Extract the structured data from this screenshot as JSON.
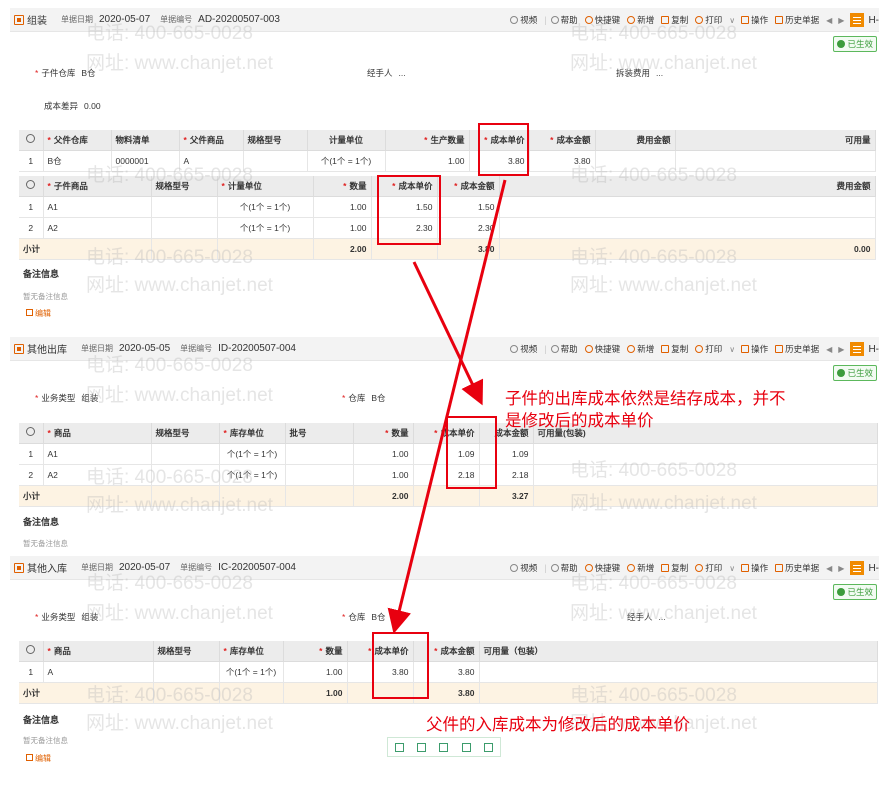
{
  "watermark": {
    "phone": "电话: 400-665-0028",
    "site": "网址: www.chanjet.net"
  },
  "common": {
    "date_label": "单据日期",
    "number_label": "单据编号",
    "subtotal_label": "小计",
    "notes_title": "备注信息",
    "notes_empty": "暂无备注信息",
    "edit_label": "编辑",
    "status": "已生效",
    "more": "H-"
  },
  "toolbar": {
    "video": "视频",
    "help": "帮助",
    "shortcut": "快捷键",
    "new": "新增",
    "copy": "复制",
    "print": "打印",
    "actions": "操作",
    "history": "历史单据"
  },
  "panel1": {
    "title": "组装",
    "date": "2020-05-07",
    "number": "AD-20200507-003",
    "child_warehouse_label": "子件仓库",
    "child_warehouse": "B仓",
    "handler_label": "经手人",
    "handler": "...",
    "disassembly_fee_label": "拆装费用",
    "disassembly_fee": "...",
    "cost_diff_label": "成本差异",
    "cost_diff": "0.00",
    "parent_headers": [
      "父件仓库",
      "物料清单",
      "父件商品",
      "规格型号",
      "计量单位",
      "生产数量",
      "成本单价",
      "成本金额",
      "费用金额",
      "可用量"
    ],
    "parent_row": {
      "no": "1",
      "warehouse": "B仓",
      "bom": "0000001",
      "product": "A",
      "spec": "",
      "unit": "个(1个 = 1个)",
      "qty": "1.00",
      "price": "3.80",
      "amount": "3.80"
    },
    "child_headers": [
      "子件商品",
      "规格型号",
      "计量单位",
      "数量",
      "成本单价",
      "成本金额",
      "费用金额"
    ],
    "child_rows": [
      {
        "no": "1",
        "product": "A1",
        "unit": "个(1个 = 1个)",
        "qty": "1.00",
        "price": "1.50",
        "amount": "1.50"
      },
      {
        "no": "2",
        "product": "A2",
        "unit": "个(1个 = 1个)",
        "qty": "1.00",
        "price": "2.30",
        "amount": "2.30"
      }
    ],
    "subtotal": {
      "qty": "2.00",
      "amount": "3.80",
      "fee": "0.00"
    }
  },
  "panel2": {
    "title": "其他出库",
    "date": "2020-05-05",
    "number": "ID-20200507-004",
    "biz_type_label": "业务类型",
    "biz_type": "组装",
    "warehouse_label": "仓库",
    "warehouse": "B仓",
    "headers": [
      "商品",
      "规格型号",
      "库存单位",
      "批号",
      "数量",
      "成本单价",
      "成本金额",
      "可用量(包装)"
    ],
    "rows": [
      {
        "no": "1",
        "product": "A1",
        "unit": "个(1个 = 1个)",
        "qty": "1.00",
        "price": "1.09",
        "amount": "1.09"
      },
      {
        "no": "2",
        "product": "A2",
        "unit": "个(1个 = 1个)",
        "qty": "1.00",
        "price": "2.18",
        "amount": "2.18"
      }
    ],
    "subtotal": {
      "qty": "2.00",
      "amount": "3.27"
    }
  },
  "panel3": {
    "title": "其他入库",
    "date": "2020-05-07",
    "number": "IC-20200507-004",
    "biz_type_label": "业务类型",
    "biz_type": "组装",
    "warehouse_label": "仓库",
    "warehouse": "B仓",
    "handler_label": "经手人",
    "handler": "...",
    "headers": [
      "商品",
      "规格型号",
      "库存单位",
      "数量",
      "成本单价",
      "成本金额",
      "可用量（包装）"
    ],
    "rows": [
      {
        "no": "1",
        "product": "A",
        "unit": "个(1个 = 1个)",
        "qty": "1.00",
        "price": "3.80",
        "amount": "3.80"
      }
    ],
    "subtotal": {
      "qty": "1.00",
      "amount": "3.80"
    }
  },
  "annotations": {
    "child_note_line1": "子件的出库成本依然是结存成本，并不",
    "child_note_line2": "是修改后的成本单价",
    "parent_note": "父件的入库成本为修改后的成本单价"
  },
  "colors": {
    "accent": "#f08a00",
    "annotation": "#e8000f",
    "status": "#3c9c3c"
  }
}
